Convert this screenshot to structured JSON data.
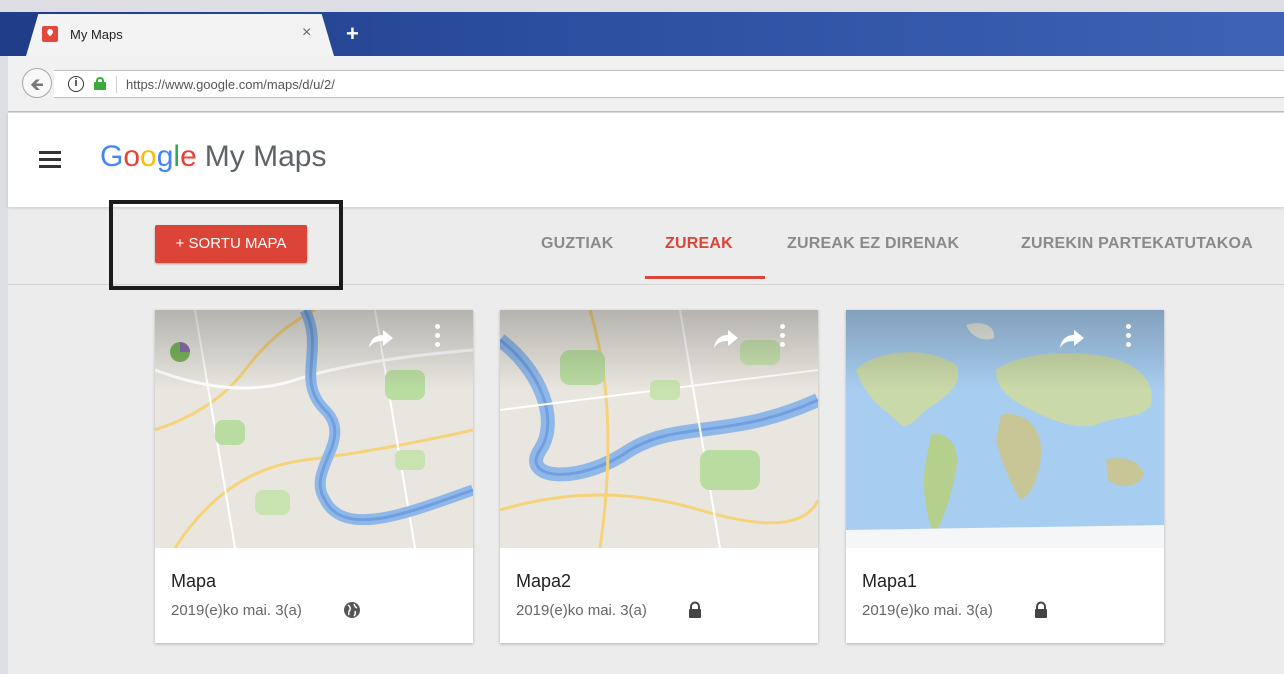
{
  "browser": {
    "tab_title": "My Maps",
    "tab_close": "×",
    "new_tab": "+",
    "url": "https://www.google.com/maps/d/u/2/",
    "info_glyph": "i"
  },
  "app": {
    "logo": {
      "g1": "G",
      "o1": "o",
      "o2": "o",
      "g2": "g",
      "l": "l",
      "e": "e",
      "product": "My Maps"
    },
    "create_button": "+ SORTU MAPA",
    "filters": [
      "GUZTIAK",
      "ZUREAK",
      "ZUREAK EZ DIRENAK",
      "ZUREKIN PARTEKATUTAKOA"
    ],
    "active_filter": "ZUREAK",
    "cards": [
      {
        "title": "Mapa",
        "date": "2019(e)ko mai. 3(a)",
        "visibility": "public-globe-icon"
      },
      {
        "title": "Mapa2",
        "date": "2019(e)ko mai. 3(a)",
        "visibility": "private-lock-icon"
      },
      {
        "title": "Mapa1",
        "date": "2019(e)ko mai. 3(a)",
        "visibility": "private-lock-icon"
      }
    ]
  },
  "colors": {
    "accent": "#db4437",
    "secure_green": "#3aa83a",
    "tabbar_blue": "#2b4d9e"
  }
}
